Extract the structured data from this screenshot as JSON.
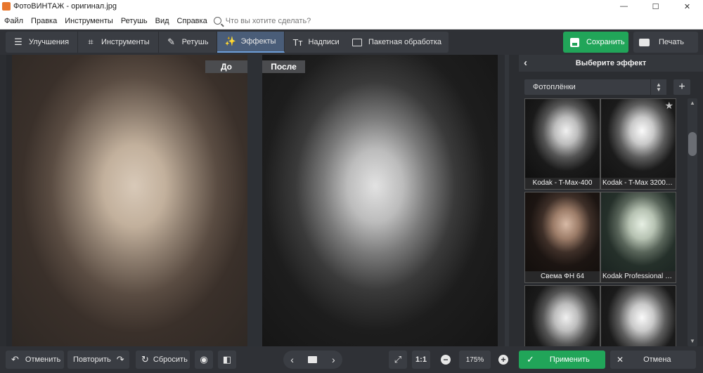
{
  "window": {
    "title": "ФотоВИНТАЖ - оригинал.jpg",
    "minimize_glyph": "—",
    "maximize_glyph": "☐",
    "close_glyph": "✕"
  },
  "menu": {
    "items": [
      "Файл",
      "Правка",
      "Инструменты",
      "Ретушь",
      "Вид",
      "Справка"
    ],
    "search_placeholder": "Что вы хотите сделать?"
  },
  "toolbar": {
    "tabs": [
      {
        "label": "Улучшения",
        "icon": "sliders-icon",
        "glyph": "☰"
      },
      {
        "label": "Инструменты",
        "icon": "crop-icon",
        "glyph": "⌗"
      },
      {
        "label": "Ретушь",
        "icon": "brush-icon",
        "glyph": "✎"
      },
      {
        "label": "Эффекты",
        "icon": "magic-wand-icon",
        "glyph": "✨"
      },
      {
        "label": "Надписи",
        "icon": "text-icon",
        "glyph": "Tт"
      }
    ],
    "active_tab": "Эффекты",
    "batch_label": "Пакетная обработка",
    "save_label": "Сохранить",
    "print_label": "Печать"
  },
  "canvas": {
    "before_label": "До",
    "after_label": "После"
  },
  "effects_panel": {
    "title": "Выберите эффект",
    "category": "Фотоплёнки",
    "thumbnails": [
      {
        "caption": "Kodak - T-Max-400"
      },
      {
        "caption": "Kodak - T-Max 3200 P..."
      },
      {
        "caption": "Свема ФН 64"
      },
      {
        "caption": "Kodak Professional BW..."
      },
      {
        "caption": ""
      },
      {
        "caption": ""
      }
    ]
  },
  "bottombar": {
    "undo_label": "Отменить",
    "redo_label": "Повторить",
    "reset_label": "Сбросить",
    "zoom_fit_label": "1:1",
    "zoom_value": "175%",
    "apply_label": "Применить",
    "cancel_label": "Отмена"
  },
  "colors": {
    "accent_green": "#21a559",
    "active_tab": "#4a5d78",
    "background": "#2b2d31"
  }
}
